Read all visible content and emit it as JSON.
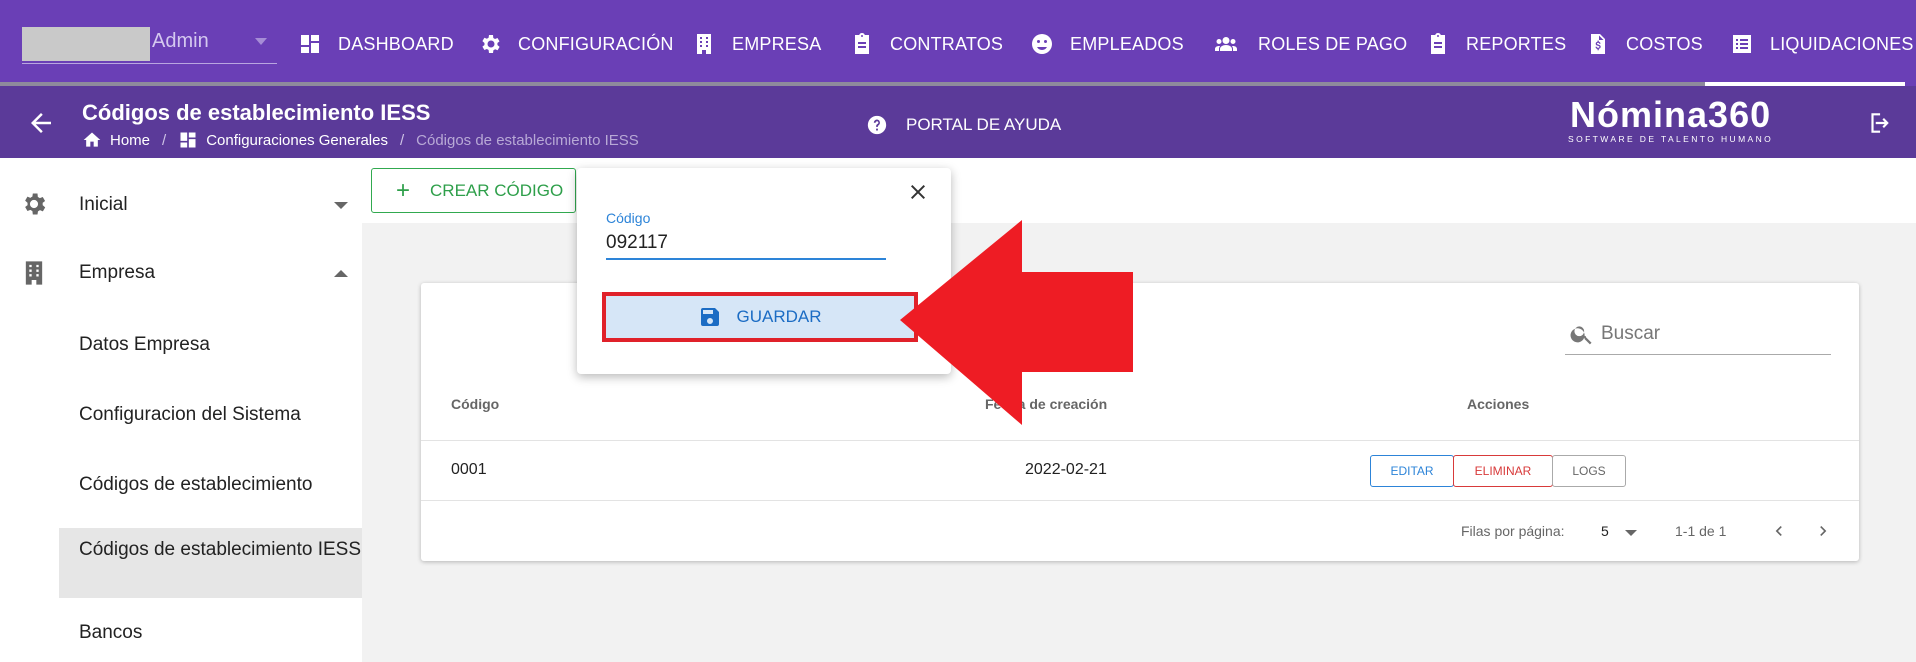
{
  "user": {
    "name": "Admin"
  },
  "nav": [
    {
      "label": "DASHBOARD",
      "icon": "dashboard-icon"
    },
    {
      "label": "CONFIGURACIÓN",
      "icon": "gear-icon"
    },
    {
      "label": "EMPRESA",
      "icon": "building-icon"
    },
    {
      "label": "CONTRATOS",
      "icon": "clipboard-icon"
    },
    {
      "label": "EMPLEADOS",
      "icon": "face-icon"
    },
    {
      "label": "ROLES DE PAGO",
      "icon": "people-icon"
    },
    {
      "label": "REPORTES",
      "icon": "clipboard-icon"
    },
    {
      "label": "COSTOS",
      "icon": "invoice-icon"
    },
    {
      "label": "LIQUIDACIONES",
      "icon": "list-icon"
    }
  ],
  "header": {
    "title": "Códigos de establecimiento IESS",
    "breadcrumb": {
      "home": "Home",
      "section": "Configuraciones Generales",
      "current": "Códigos de establecimiento IESS"
    },
    "help": "PORTAL DE AYUDA",
    "logo": {
      "main": "Nómina360",
      "sub": "SOFTWARE DE TALENTO HUMANO"
    }
  },
  "sidebar": {
    "groups": [
      {
        "label": "Inicial",
        "icon": "gear-icon",
        "expanded": false
      },
      {
        "label": "Empresa",
        "icon": "building-icon",
        "expanded": true
      }
    ],
    "subitems": [
      {
        "label": "Datos Empresa"
      },
      {
        "label": "Configuracion del Sistema"
      },
      {
        "label": "Códigos de establecimiento"
      },
      {
        "label": "Códigos de establecimiento IESS",
        "active": true
      },
      {
        "label": "Bancos"
      }
    ]
  },
  "toolbar": {
    "create_label": "CREAR CÓDIGO"
  },
  "popover": {
    "field_label": "Código",
    "field_value": "092117",
    "save_label": "GUARDAR"
  },
  "table": {
    "search_placeholder": "Buscar",
    "columns": [
      "Código",
      "Fecha de creación",
      "Acciones"
    ],
    "rows": [
      {
        "code": "0001",
        "date": "2022-02-21"
      }
    ],
    "actions": {
      "edit": "EDITAR",
      "delete": "ELIMINAR",
      "logs": "LOGS"
    },
    "footer": {
      "rows_per_page_label": "Filas por página:",
      "rows_per_page": "5",
      "range": "1-1 de 1"
    }
  },
  "colors": {
    "nav": "#6a3fb6",
    "header": "#5b3a99",
    "primary": "#2d84d8",
    "success": "#31a94f",
    "danger": "#d83a3a",
    "highlight": "#e0212a"
  }
}
